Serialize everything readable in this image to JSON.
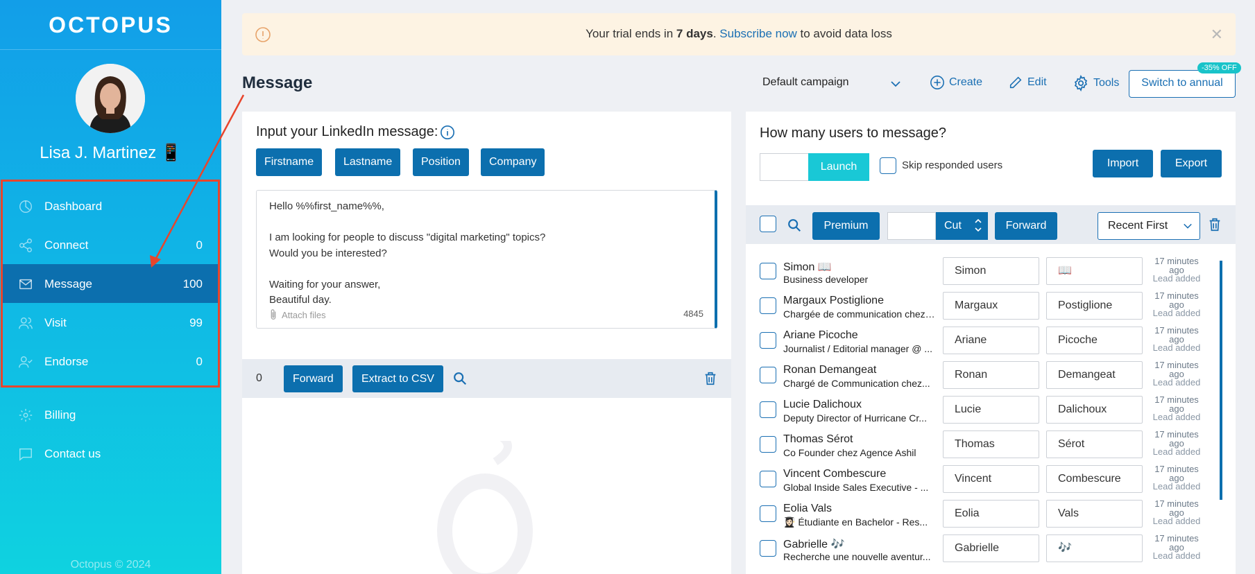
{
  "sidebar": {
    "logo": "OCTOPUS",
    "user_name": "Lisa J. Martinez 📱",
    "nav": [
      {
        "label": "Dashboard",
        "count": ""
      },
      {
        "label": "Connect",
        "count": "0"
      },
      {
        "label": "Message",
        "count": "100"
      },
      {
        "label": "Visit",
        "count": "99"
      },
      {
        "label": "Endorse",
        "count": "0"
      }
    ],
    "extra": [
      {
        "label": "Billing"
      },
      {
        "label": "Contact us"
      }
    ],
    "footer": "Octopus © 2024"
  },
  "banner": {
    "prefix": "Your trial ends in ",
    "days": "7 days",
    "dot": ".",
    "link": "Subscribe now",
    "suffix": " to avoid data loss",
    "close": "✕"
  },
  "header": {
    "title": "Message",
    "campaign": "Default campaign",
    "create": "Create",
    "edit": "Edit",
    "tools": "Tools",
    "switch_annual": "Switch to annual",
    "discount_badge": "-35% OFF"
  },
  "composer": {
    "title": "Input your LinkedIn message:",
    "tags": [
      "Firstname",
      "Lastname",
      "Position",
      "Company"
    ],
    "message": "Hello %%first_name%%,\n\nI am looking for people to discuss \"digital marketing\" topics?\nWould you be interested?\n\nWaiting for your answer,\nBeautiful day.",
    "attach": "Attach files",
    "char_count": "4845"
  },
  "queue_bar": {
    "count": "0",
    "forward": "Forward",
    "extract": "Extract to CSV"
  },
  "users_panel": {
    "title": "How many users to message?",
    "launch": "Launch",
    "skip_label": "Skip responded users",
    "import": "Import",
    "export": "Export",
    "premium": "Premium",
    "cut": "Cut",
    "forward": "Forward",
    "sort": "Recent First",
    "rows": [
      {
        "name": "Simon 📖",
        "title": "Business developer",
        "first": "Simon",
        "last": "📖",
        "time": "17 minutes ago",
        "status": "Lead added"
      },
      {
        "name": "Margaux Postiglione",
        "title": "Chargée de communication chez Groupe...",
        "first": "Margaux",
        "last": "Postiglione",
        "time": "17 minutes ago",
        "status": "Lead added"
      },
      {
        "name": "Ariane Picoche",
        "title": "Journalist / Editorial manager @ ...",
        "first": "Ariane",
        "last": "Picoche",
        "time": "17 minutes ago",
        "status": "Lead added"
      },
      {
        "name": "Ronan Demangeat",
        "title": "Chargé de Communication chez...",
        "first": "Ronan",
        "last": "Demangeat",
        "time": "17 minutes ago",
        "status": "Lead added"
      },
      {
        "name": "Lucie Dalichoux",
        "title": "Deputy Director of Hurricane Cr...",
        "first": "Lucie",
        "last": "Dalichoux",
        "time": "17 minutes ago",
        "status": "Lead added"
      },
      {
        "name": "Thomas Sérot",
        "title": "Co Founder chez Agence Ashil",
        "first": "Thomas",
        "last": "Sérot",
        "time": "17 minutes ago",
        "status": "Lead added"
      },
      {
        "name": "Vincent Combescure",
        "title": "Global Inside Sales Executive - ...",
        "first": "Vincent",
        "last": "Combescure",
        "time": "17 minutes ago",
        "status": "Lead added"
      },
      {
        "name": "Eolia Vals",
        "title": "👩🏻‍🎓 Étudiante en Bachelor - Res...",
        "first": "Eolia",
        "last": "Vals",
        "time": "17 minutes ago",
        "status": "Lead added"
      },
      {
        "name": "Gabrielle 🎶",
        "title": "Recherche une nouvelle aventur...",
        "first": "Gabrielle",
        "last": "🎶",
        "time": "17 minutes ago",
        "status": "Lead added"
      }
    ]
  },
  "colors": {
    "primary": "#0c6fae",
    "accent": "#19c8d6",
    "sidebar_top": "#129ee8",
    "sidebar_bottom": "#0fd2e0",
    "annotation": "#e8452c"
  }
}
